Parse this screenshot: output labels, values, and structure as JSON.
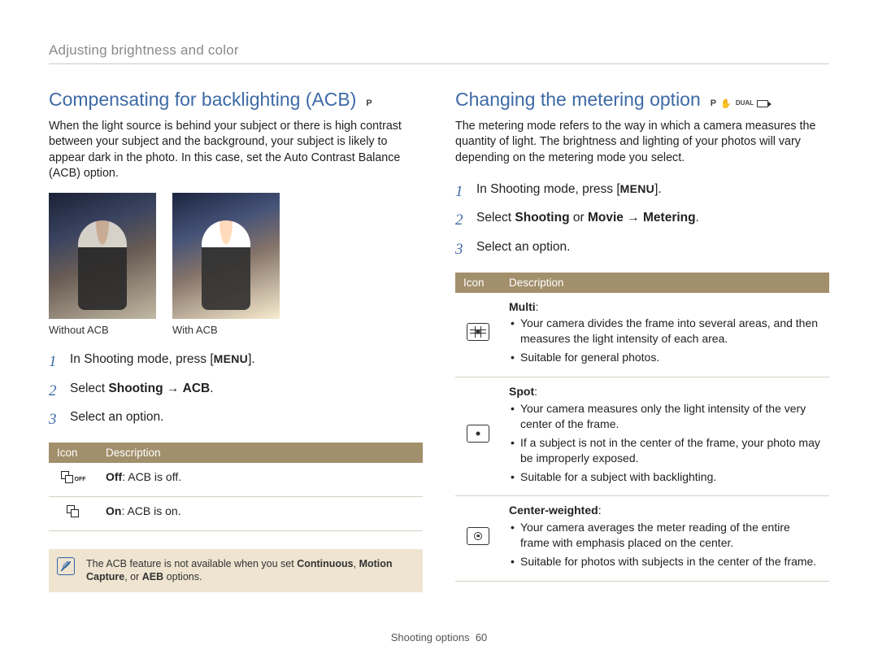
{
  "breadcrumb": "Adjusting brightness and color",
  "left": {
    "title": "Compensating for backlighting (ACB)",
    "mode_glyph": "P",
    "intro": "When the light source is behind your subject or there is high contrast between your subject and the background, your subject is likely to appear dark in the photo. In this case, set the Auto Contrast Balance (ACB) option.",
    "caption_without": "Without ACB",
    "caption_with": "With ACB",
    "steps": {
      "s1_pre": "In Shooting mode, press [",
      "s1_key": "MENU",
      "s1_post": "].",
      "s2_pre": "Select ",
      "s2_b1": "Shooting",
      "s2_arrow": " → ",
      "s2_b2": "ACB",
      "s2_post": ".",
      "s3": "Select an option."
    },
    "table": {
      "h_icon": "Icon",
      "h_desc": "Description",
      "rows": [
        {
          "label": "Off",
          "text": ": ACB is off.",
          "suffix": "OFF"
        },
        {
          "label": "On",
          "text": ": ACB is on.",
          "suffix": ""
        }
      ]
    },
    "note_pre": "The ACB feature is not available when you set ",
    "note_b1": "Continuous",
    "note_mid1": ", ",
    "note_b2": "Motion Capture",
    "note_mid2": ", or ",
    "note_b3": "AEB",
    "note_post": " options."
  },
  "right": {
    "title": "Changing the metering option",
    "mode_glyph": "P",
    "intro": "The metering mode refers to the way in which a camera measures the quantity of light. The brightness and lighting of your photos will vary depending on the metering mode you select.",
    "steps": {
      "s1_pre": "In Shooting mode, press [",
      "s1_key": "MENU",
      "s1_post": "].",
      "s2_pre": "Select ",
      "s2_b1": "Shooting",
      "s2_or": " or ",
      "s2_b2": "Movie",
      "s2_arrow": " → ",
      "s2_b3": "Metering",
      "s2_post": ".",
      "s3": "Select an option."
    },
    "table": {
      "h_icon": "Icon",
      "h_desc": "Description",
      "multi": {
        "title": "Multi",
        "b1": "Your camera divides the frame into several areas, and then measures the light intensity of each area.",
        "b2": "Suitable for general photos."
      },
      "spot": {
        "title": "Spot",
        "b1": "Your camera measures only the light intensity of the very center of the frame.",
        "b2": "If a subject is not in the center of the frame, your photo may be improperly exposed.",
        "b3": "Suitable for a subject with backlighting."
      },
      "center": {
        "title": "Center-weighted",
        "b1": "Your camera averages the meter reading of the entire frame with emphasis placed on the center.",
        "b2": "Suitable for photos with subjects in the center of the frame."
      }
    }
  },
  "footer_section": "Shooting options",
  "footer_page": "60"
}
